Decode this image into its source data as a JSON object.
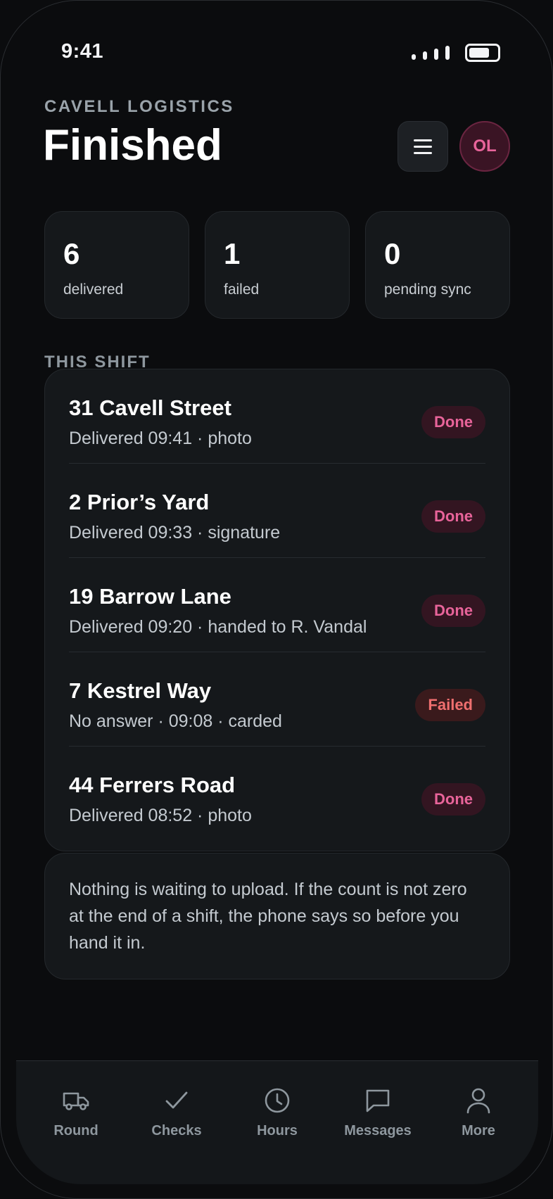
{
  "status_bar": {
    "time": "9:41"
  },
  "header": {
    "eyebrow": "CAVELL LOGISTICS",
    "title": "Finished",
    "avatar_initials": "OL"
  },
  "stats": [
    {
      "value": "6",
      "label": "delivered"
    },
    {
      "value": "1",
      "label": "failed"
    },
    {
      "value": "0",
      "label": "pending sync"
    }
  ],
  "section_label": "THIS SHIFT",
  "deliveries": [
    {
      "address": "31 Cavell Street",
      "detail": "Delivered 09:41 · photo",
      "status": "Done"
    },
    {
      "address": "2 Prior’s Yard",
      "detail": "Delivered 09:33 · signature",
      "status": "Done"
    },
    {
      "address": "19 Barrow Lane",
      "detail": "Delivered 09:20 · handed to R. Vandal",
      "status": "Done"
    },
    {
      "address": "7 Kestrel Way",
      "detail": "No answer · 09:08 · carded",
      "status": "Failed"
    },
    {
      "address": "44 Ferrers Road",
      "detail": "Delivered 08:52 · photo",
      "status": "Done"
    }
  ],
  "note": "Nothing is waiting to upload. If the count is not zero at the end of a shift, the phone says so before you hand it in.",
  "tabs": [
    {
      "label": "Round",
      "icon": "truck-icon"
    },
    {
      "label": "Checks",
      "icon": "check-icon"
    },
    {
      "label": "Hours",
      "icon": "clock-icon"
    },
    {
      "label": "Messages",
      "icon": "message-icon"
    },
    {
      "label": "More",
      "icon": "person-icon"
    }
  ],
  "colors": {
    "accent": "#e8649a",
    "done_pill_bg": "#331521",
    "failed_text": "#ef6f6f",
    "failed_pill_bg": "#3a1a1c",
    "background": "#0b0c0e",
    "card": "#15181b"
  }
}
